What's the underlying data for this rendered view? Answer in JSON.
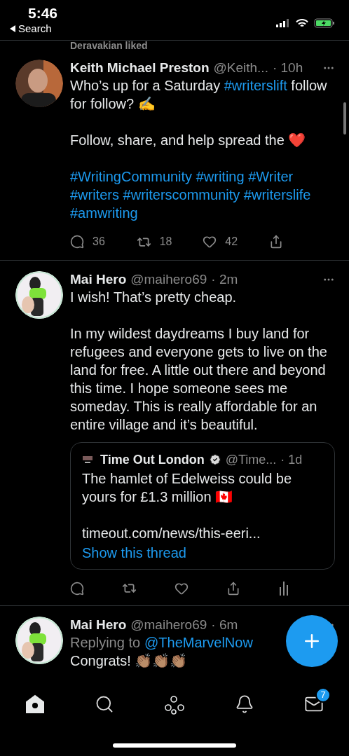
{
  "status_bar": {
    "time": "5:46",
    "back_label": "Search"
  },
  "tweets": [
    {
      "context": "Deravakian liked",
      "name": "Keith Michael Preston",
      "handle": "@Keith...",
      "time": "· 10h",
      "paragraphs": [
        [
          {
            "kind": "text",
            "text": "Who’s up for a Saturday "
          },
          {
            "kind": "link",
            "text": "#writerslift"
          },
          {
            "kind": "text",
            "text": " follow for follow? ✍️"
          }
        ],
        [
          {
            "kind": "text",
            "text": "Follow, share, and help spread the ❤️"
          }
        ],
        [
          {
            "kind": "link",
            "text": "#WritingCommunity"
          },
          {
            "kind": "link",
            "text": "#writing"
          },
          {
            "kind": "link",
            "text": "#Writer"
          },
          {
            "kind": "link",
            "text": "#writers"
          },
          {
            "kind": "link",
            "text": "#writerscommunity"
          },
          {
            "kind": "link",
            "text": "#writerslife"
          },
          {
            "kind": "link",
            "text": "#amwriting"
          }
        ]
      ],
      "actions": [
        {
          "kind": "reply",
          "count": "36"
        },
        {
          "kind": "retweet",
          "count": "18"
        },
        {
          "kind": "like",
          "count": "42"
        },
        {
          "kind": "share"
        }
      ]
    },
    {
      "name": "Mai Hero",
      "handle": "@maihero69",
      "time": "· 2m",
      "paragraphs": [
        [
          {
            "kind": "text",
            "text": "I wish! That’s pretty cheap."
          }
        ],
        [
          {
            "kind": "text",
            "text": "In my wildest daydreams I buy land for refugees and everyone gets to live on the land for free. A little out there and beyond this time. I hope someone sees me someday. This is really affordable for an entire village and it’s beautiful."
          }
        ]
      ],
      "quote": {
        "name": "Time Out London",
        "verified": true,
        "handle": "@Time...",
        "time": "· 1d",
        "text": "The hamlet of Edelweiss could be yours for £1.3 million 🇨🇦",
        "link": "timeout.com/news/this-eeri...",
        "thread": "Show this thread"
      },
      "actions": [
        {
          "kind": "reply"
        },
        {
          "kind": "retweet"
        },
        {
          "kind": "like"
        },
        {
          "kind": "share"
        },
        {
          "kind": "analytics"
        }
      ]
    },
    {
      "name": "Mai Hero",
      "handle": "@maihero69",
      "time": "· 6m",
      "replying_to": {
        "prefix": "Replying to",
        "user": "@TheMarvelNow"
      },
      "paragraphs": [
        [
          {
            "kind": "text",
            "text": "Congrats! 👏🏽👏🏽👏🏽"
          }
        ]
      ]
    }
  ],
  "tab_bar": [
    {
      "kind": "home",
      "selected": true
    },
    {
      "kind": "search",
      "selected": false
    },
    {
      "kind": "spaces",
      "selected": false
    },
    {
      "kind": "notifications",
      "selected": false
    },
    {
      "kind": "messages",
      "selected": false,
      "badge": "7"
    }
  ]
}
